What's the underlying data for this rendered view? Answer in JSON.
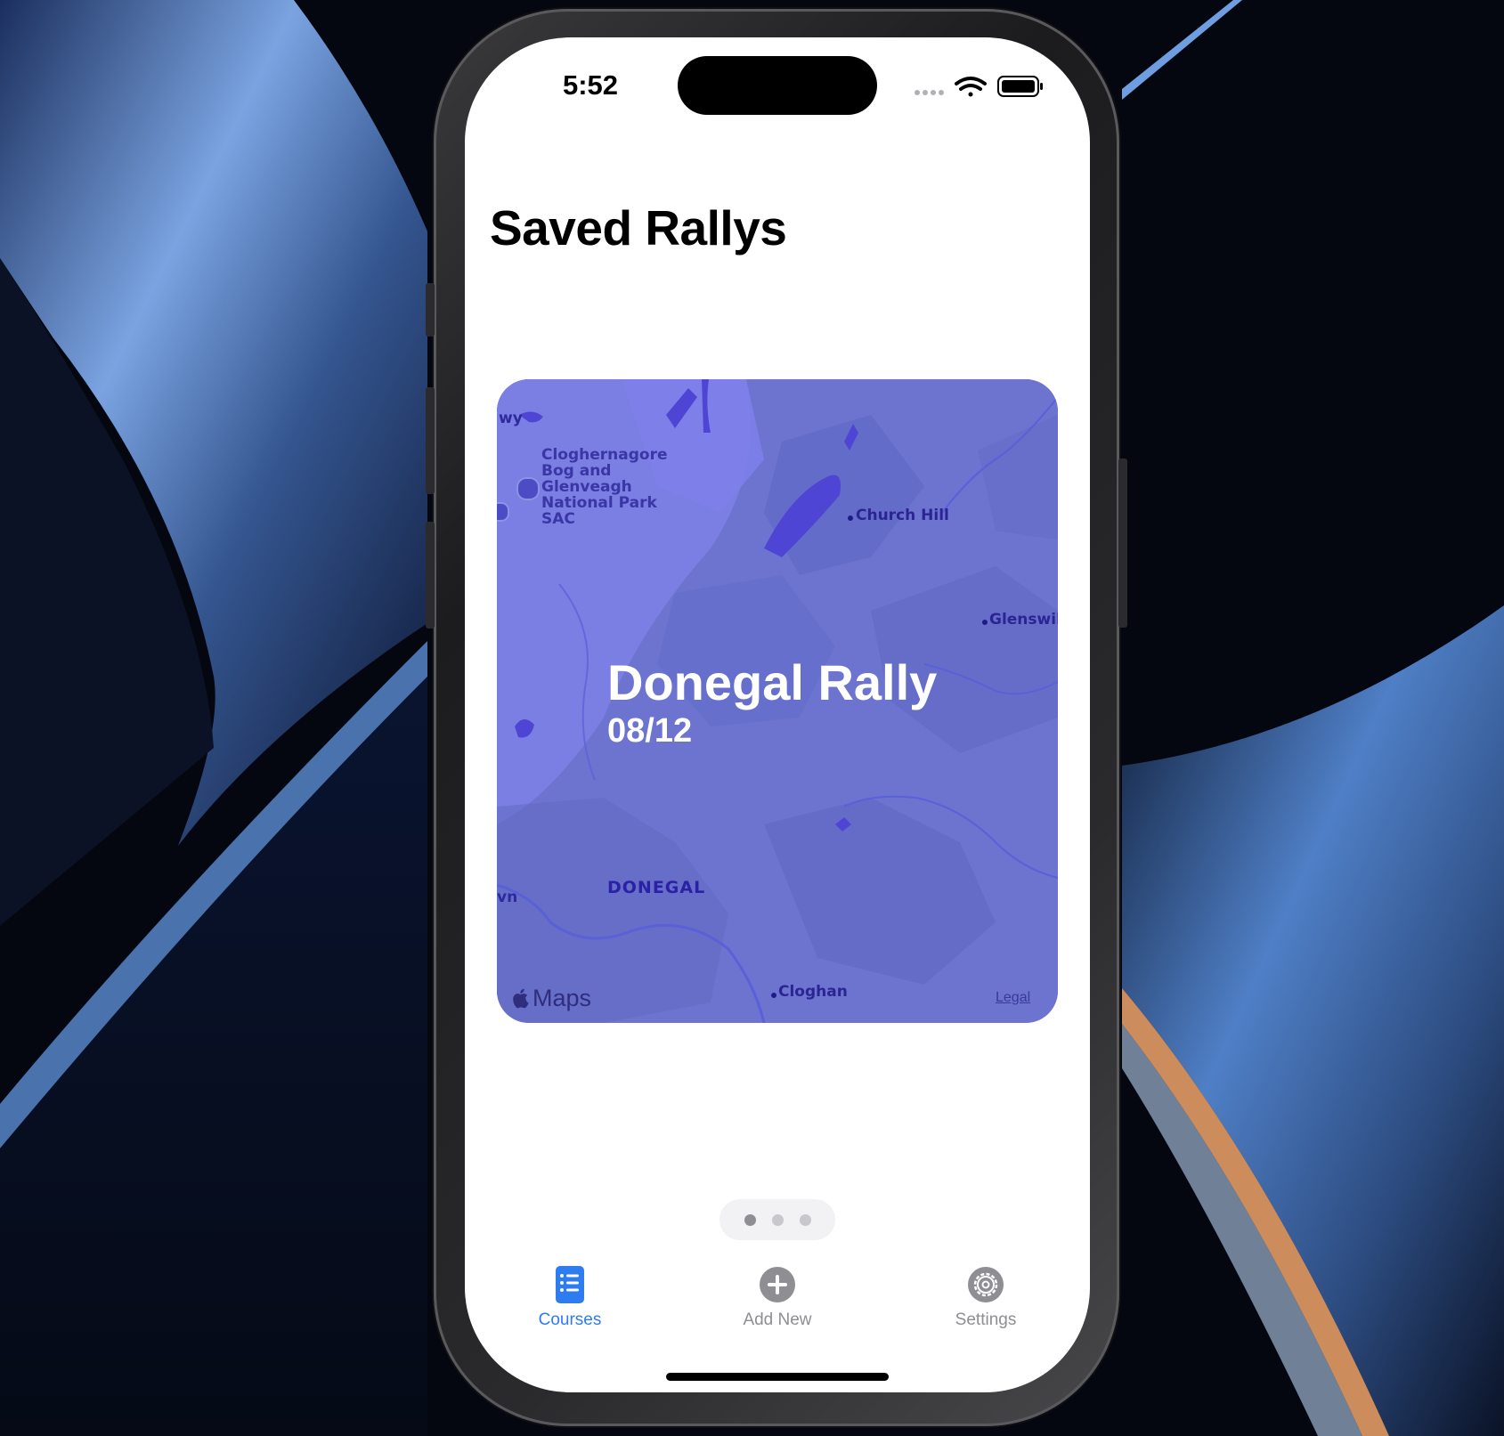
{
  "status_bar": {
    "time": "5:52",
    "icons": [
      "signal-dots-icon",
      "wifi-icon",
      "battery-icon"
    ]
  },
  "page": {
    "title": "Saved Rallys"
  },
  "rally_card": {
    "name": "Donegal Rally",
    "date": "08/12",
    "map": {
      "poi_name": "Cloghernagore Bog and Glenveagh National Park SAC",
      "labels": {
        "church_hill": "Church Hill",
        "glenswill": "Glenswill",
        "cloghan": "Cloghan",
        "region": "DONEGAL",
        "edge_top": "wy",
        "edge_left": "vn"
      },
      "attribution": "Maps",
      "legal": "Legal"
    }
  },
  "pager": {
    "count": 3,
    "active_index": 0
  },
  "tab_bar": {
    "tabs": [
      {
        "label": "Courses",
        "icon": "list-document-icon",
        "selected": true
      },
      {
        "label": "Add New",
        "icon": "plus-circle-icon",
        "selected": false
      },
      {
        "label": "Settings",
        "icon": "gear-icon",
        "selected": false
      }
    ]
  },
  "colors": {
    "accent": "#2f7bf0",
    "card_map": "#6b73cf",
    "inactive": "#8e8e93"
  }
}
